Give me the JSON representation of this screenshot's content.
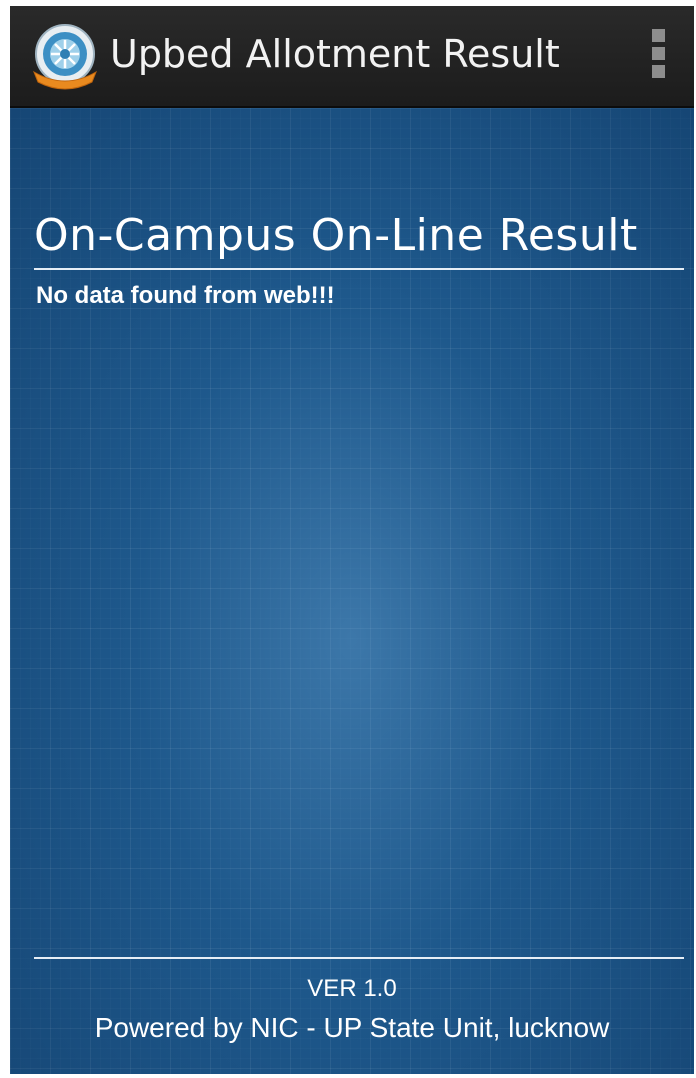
{
  "action_bar": {
    "title": "Upbed Allotment Result",
    "logo_icon": "upbed-emblem-logo",
    "menu_icon": "overflow-menu-icon"
  },
  "main": {
    "section_title": "On-Campus On-Line Result",
    "status_message": "No data found from web!!!"
  },
  "footer": {
    "version": "VER 1.0",
    "powered_by": "Powered by NIC - UP State Unit, lucknow"
  },
  "colors": {
    "action_bar_bg": "#1f1f1f",
    "content_bg": "#1c5688",
    "text": "#ffffff"
  }
}
